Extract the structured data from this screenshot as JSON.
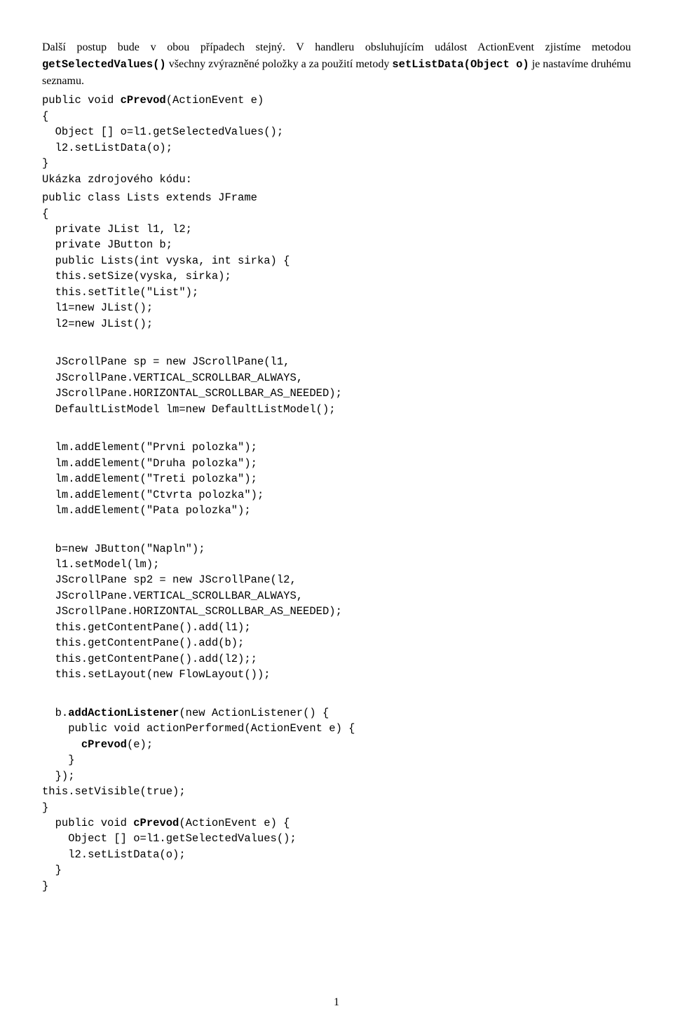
{
  "para1_a": "Další postup bude v obou případech stejný. V handleru obsluhujícím událost ActionEvent zjistíme metodou ",
  "para1_b": "getSelectedValues()",
  "para1_c": " všechny zvýrazněné položky a za použití metody ",
  "para1_d": "setListData(Object o)",
  "para1_e": " je nastavíme druhému seznamu.",
  "code1_l1a": "public void ",
  "code1_l1b": "cPrevod",
  "code1_l1c": "(ActionEvent e)",
  "code1_l2": "{",
  "code1_l3": "  Object [] o=l1.getSelectedValues();",
  "code1_l4": "  l2.setListData(o);",
  "code1_l5": "}",
  "code1_l6": "Ukázka zdrojového kódu:",
  "code2_l1": "public class Lists extends JFrame",
  "code2_l2": "{",
  "code2_l3": "  private JList l1, l2;",
  "code2_l4": "  private JButton b;",
  "code2_l5": "  public Lists(int vyska, int sirka) {",
  "code2_l6": "  this.setSize(vyska, sirka);",
  "code2_l7": "  this.setTitle(\"List\");",
  "code2_l8": "  l1=new JList();",
  "code2_l9": "  l2=new JList();",
  "code3_l1": "  JScrollPane sp = new JScrollPane(l1,",
  "code3_l2": "  JScrollPane.VERTICAL_SCROLLBAR_ALWAYS,",
  "code3_l3": "  JScrollPane.HORIZONTAL_SCROLLBAR_AS_NEEDED);",
  "code3_l4": "  DefaultListModel lm=new DefaultListModel();",
  "code4_l1": "  lm.addElement(\"Prvni polozka\");",
  "code4_l2": "  lm.addElement(\"Druha polozka\");",
  "code4_l3": "  lm.addElement(\"Treti polozka\");",
  "code4_l4": "  lm.addElement(\"Ctvrta polozka\");",
  "code4_l5": "  lm.addElement(\"Pata polozka\");",
  "code5_l1": "  b=new JButton(\"Napln\");",
  "code5_l2": "  l1.setModel(lm);",
  "code5_l3": "  JScrollPane sp2 = new JScrollPane(l2,",
  "code5_l4": "  JScrollPane.VERTICAL_SCROLLBAR_ALWAYS,",
  "code5_l5": "  JScrollPane.HORIZONTAL_SCROLLBAR_AS_NEEDED);",
  "code5_l6": "  this.getContentPane().add(l1);",
  "code5_l7": "  this.getContentPane().add(b);",
  "code5_l8": "  this.getContentPane().add(l2);;",
  "code5_l9": "  this.setLayout(new FlowLayout());",
  "code6_l1a": "  b.",
  "code6_l1b": "addActionListener",
  "code6_l1c": "(new ActionListener() {",
  "code6_l2": "    public void actionPerformed(ActionEvent e) {",
  "code6_l3a": "      ",
  "code6_l3b": "cPrevod",
  "code6_l3c": "(e);",
  "code6_l4": "    }",
  "code6_l5": "  });",
  "code6_l6": "this.setVisible(true);",
  "code6_l7": "}",
  "code7_l1a": "  public void ",
  "code7_l1b": "cPrevod",
  "code7_l1c": "(ActionEvent e) {",
  "code7_l2": "    Object [] o=l1.getSelectedValues();",
  "code7_l3": "    l2.setListData(o);",
  "code7_l4": "  }",
  "code7_l5": "}",
  "page_number": "1"
}
